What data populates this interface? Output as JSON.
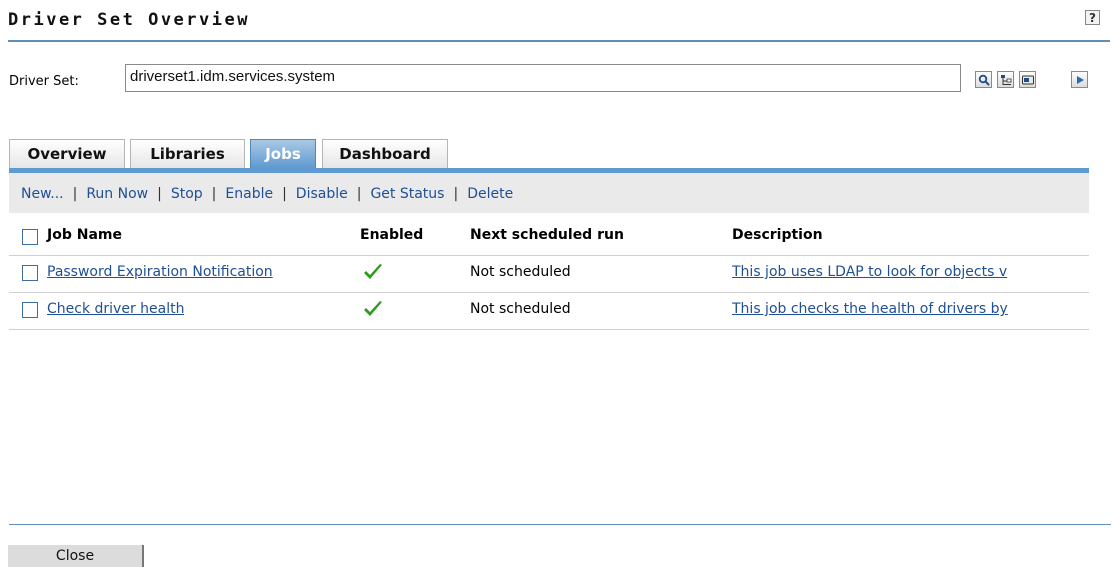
{
  "page": {
    "title": "Driver Set Overview",
    "help_label": "?"
  },
  "driver_set": {
    "label": "Driver Set:",
    "value": "driverset1.idm.services.system"
  },
  "toolbar_icons": [
    "search-icon",
    "tree-browse-icon",
    "object-history-icon",
    "play-arrow-icon"
  ],
  "tabs": [
    {
      "label": "Overview",
      "active": false
    },
    {
      "label": "Libraries",
      "active": false
    },
    {
      "label": "Jobs",
      "active": true
    },
    {
      "label": "Dashboard",
      "active": false
    }
  ],
  "actions": [
    "New...",
    "Run Now",
    "Stop",
    "Enable",
    "Disable",
    "Get Status",
    "Delete"
  ],
  "table": {
    "headers": {
      "job_name": "Job Name",
      "enabled": "Enabled",
      "next_run": "Next scheduled run",
      "description": "Description"
    },
    "rows": [
      {
        "job_name": "Password Expiration Notification",
        "enabled": true,
        "next_run": "Not scheduled",
        "description": "This job uses LDAP to look for objects v"
      },
      {
        "job_name": "Check driver health",
        "enabled": true,
        "next_run": "Not scheduled",
        "description": "This job checks the health of drivers by"
      }
    ]
  },
  "footer": {
    "close_label": "Close"
  },
  "colors": {
    "accent": "#5f9ad0",
    "link": "#1f4f95",
    "check": "#2e9a1e"
  }
}
